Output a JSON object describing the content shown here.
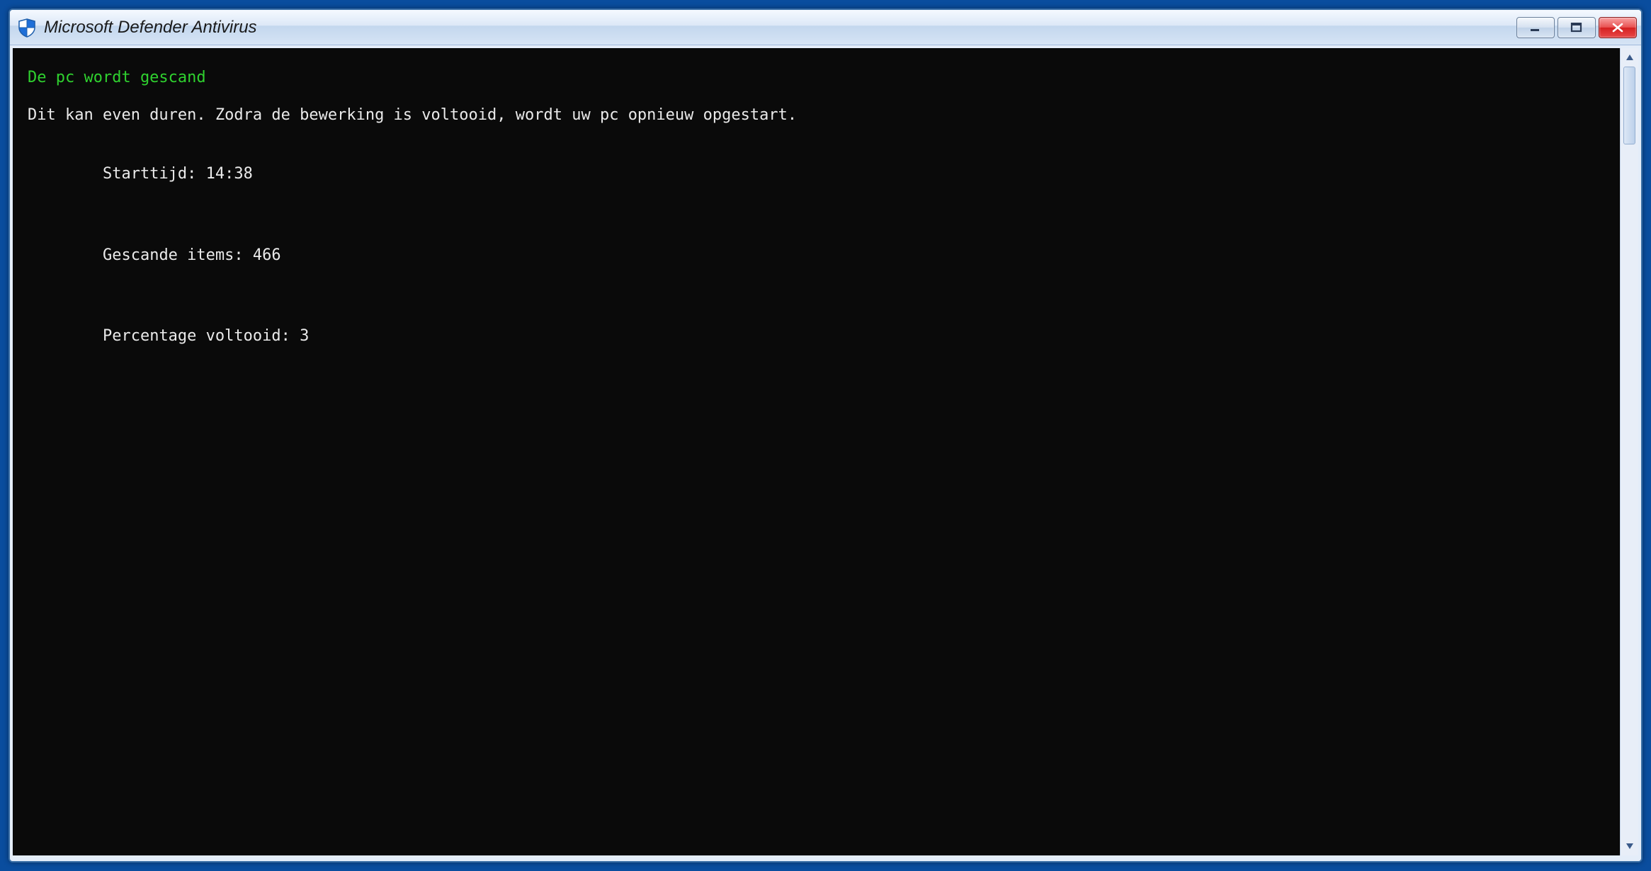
{
  "window": {
    "title": "Microsoft Defender Antivirus"
  },
  "console": {
    "heading": "De pc wordt gescand",
    "info": "Dit kan even duren. Zodra de bewerking is voltooid, wordt uw pc opnieuw opgestart.",
    "start_label": "Starttijd:",
    "start_value": "14:38",
    "scanned_label": "Gescande items:",
    "scanned_value": "466",
    "percent_label": "Percentage voltooid:",
    "percent_value": "3"
  }
}
